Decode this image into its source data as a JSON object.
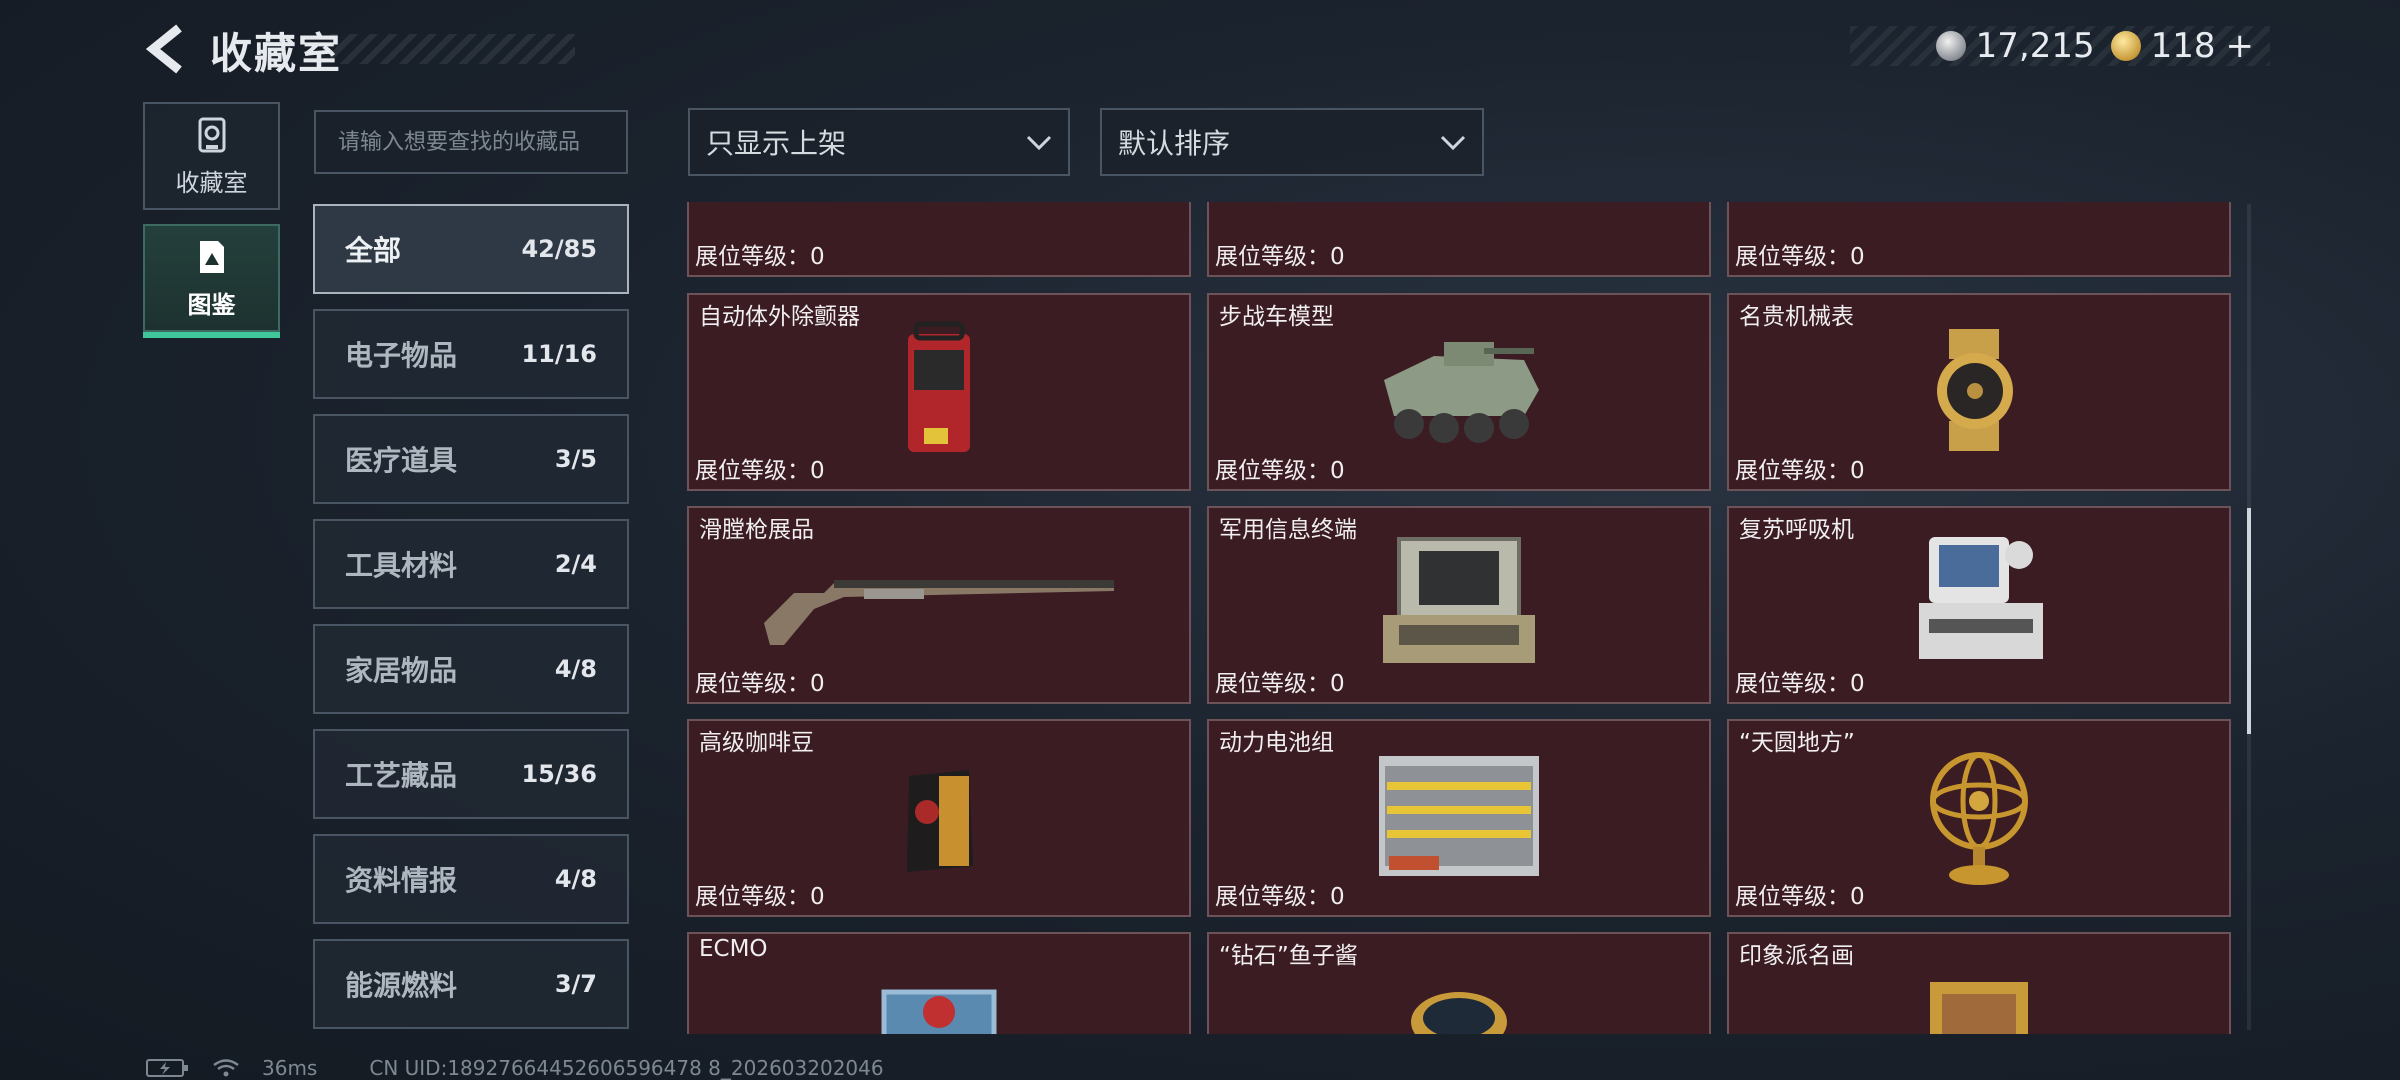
{
  "header": {
    "title": "收藏室",
    "currencies": [
      {
        "icon": "silver-coin-icon",
        "value": "17,215"
      },
      {
        "icon": "gold-coin-icon",
        "value": "118"
      }
    ],
    "plus": "+"
  },
  "sidebar": {
    "tabs": [
      {
        "label": "收藏室",
        "icon": "vault-icon",
        "active": false
      },
      {
        "label": "图鉴",
        "icon": "catalog-icon",
        "active": true
      }
    ]
  },
  "search": {
    "placeholder": "请输入想要查找的收藏品"
  },
  "categories": [
    {
      "name": "全部",
      "count": "42/85",
      "active": true
    },
    {
      "name": "电子物品",
      "count": "11/16"
    },
    {
      "name": "医疗道具",
      "count": "3/5"
    },
    {
      "name": "工具材料",
      "count": "2/4"
    },
    {
      "name": "家居物品",
      "count": "4/8"
    },
    {
      "name": "工艺藏品",
      "count": "15/36"
    },
    {
      "name": "资料情报",
      "count": "4/8"
    },
    {
      "name": "能源燃料",
      "count": "3/7"
    }
  ],
  "filters": {
    "availability": "只显示上架",
    "sort": "默认排序"
  },
  "level_label": "展位等级：0",
  "items": [
    {
      "name": "",
      "icon": "picture-frame-icon"
    },
    {
      "name": "",
      "icon": "device-icon"
    },
    {
      "name": "",
      "icon": "gadget-icon"
    },
    {
      "name": "自动体外除颤器",
      "icon": "defibrillator-icon"
    },
    {
      "name": "步战车模型",
      "icon": "ifv-model-icon"
    },
    {
      "name": "名贵机械表",
      "icon": "watch-icon"
    },
    {
      "name": "滑膛枪展品",
      "icon": "musket-icon"
    },
    {
      "name": "军用信息终端",
      "icon": "terminal-icon"
    },
    {
      "name": "复苏呼吸机",
      "icon": "ventilator-icon"
    },
    {
      "name": "高级咖啡豆",
      "icon": "coffee-bag-icon"
    },
    {
      "name": "动力电池组",
      "icon": "battery-pack-icon"
    },
    {
      "name": "“天圆地方”",
      "icon": "armillary-sphere-icon"
    },
    {
      "name": "ECMO",
      "icon": "ecmo-icon"
    },
    {
      "name": "“钻石”鱼子酱",
      "icon": "caviar-tin-icon"
    },
    {
      "name": "印象派名画",
      "icon": "painting-icon"
    }
  ],
  "footer": {
    "ping": "36ms",
    "uid": "CN UID:18927664452606596478 8_202603202046"
  }
}
